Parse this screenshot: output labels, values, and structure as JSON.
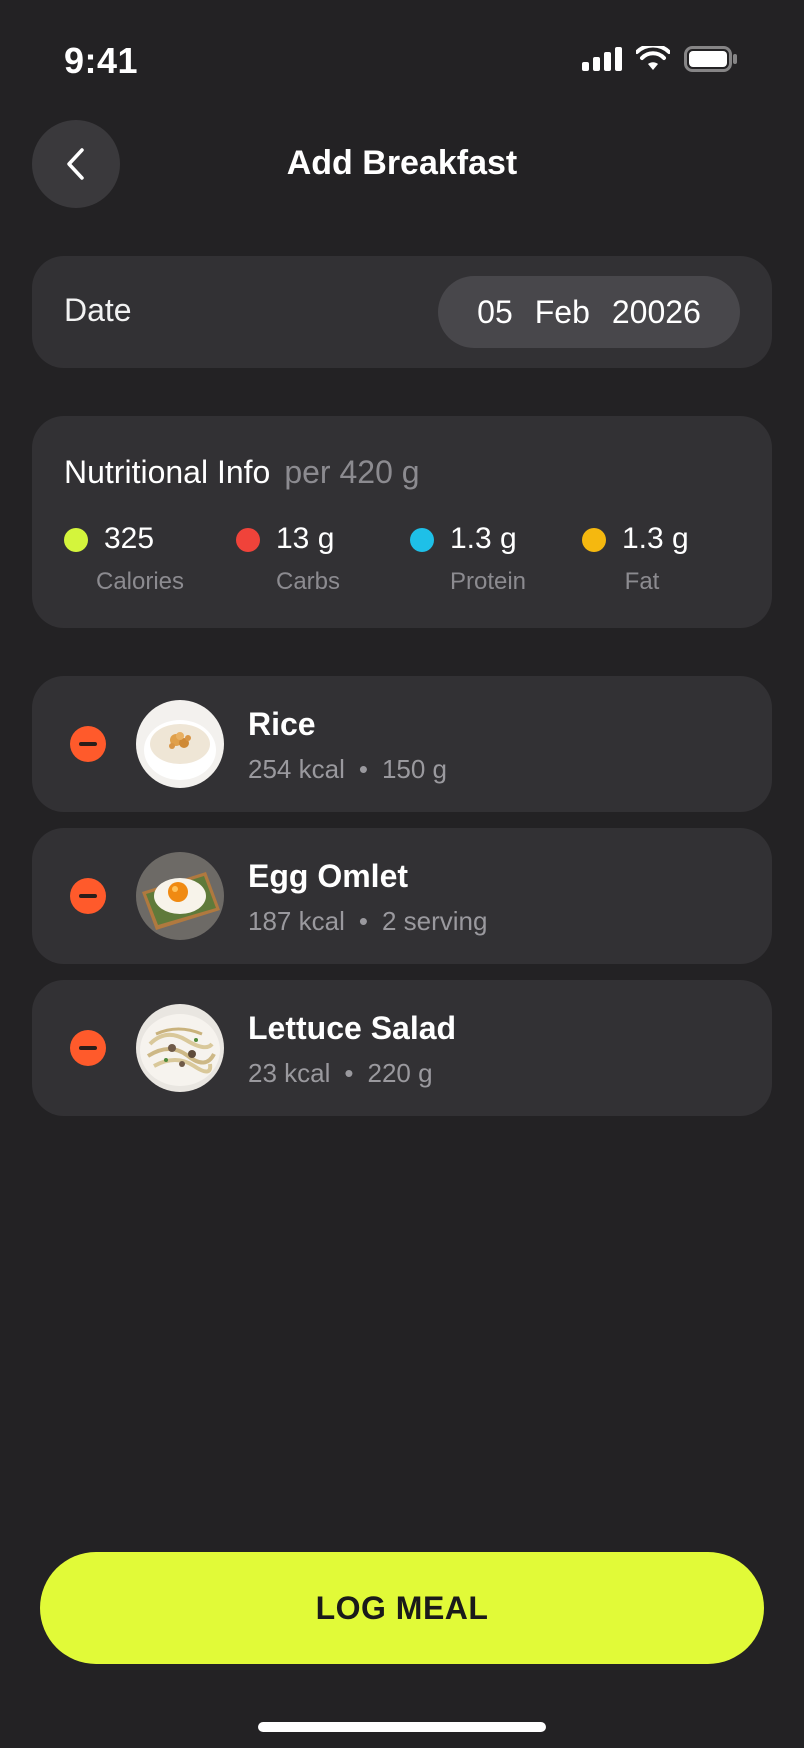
{
  "status": {
    "time": "9:41"
  },
  "header": {
    "title": "Add Breakfast"
  },
  "date": {
    "label": "Date",
    "day": "05",
    "month": "Feb",
    "year": "20026"
  },
  "nutrition": {
    "title": "Nutritional Info",
    "per": "per 420 g",
    "items": [
      {
        "value": "325",
        "label": "Calories",
        "color": "#d4f53c"
      },
      {
        "value": "13 g",
        "label": "Carbs",
        "color": "#f0433a"
      },
      {
        "value": "1.3 g",
        "label": "Protein",
        "color": "#1ec0e8"
      },
      {
        "value": "1.3 g",
        "label": "Fat",
        "color": "#f5b80f"
      }
    ]
  },
  "foods": [
    {
      "name": "Rice",
      "kcal": "254 kcal",
      "amount": "150 g",
      "image": "rice-bowl"
    },
    {
      "name": "Egg Omlet",
      "kcal": "187 kcal",
      "amount": "2 serving",
      "image": "egg-toast"
    },
    {
      "name": "Lettuce Salad",
      "kcal": "23 kcal",
      "amount": "220 g",
      "image": "pasta-salad"
    }
  ],
  "separator": "•",
  "actions": {
    "log_meal": "LOG MEAL"
  },
  "colors": {
    "accent": "#e1fa38",
    "remove": "#ff5a2b",
    "background": "#232224",
    "card": "#323134"
  }
}
